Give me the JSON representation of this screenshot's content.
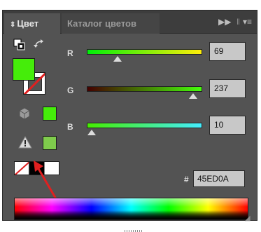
{
  "tabs": [
    {
      "label": "Цвет",
      "active": true
    },
    {
      "label": "Каталог цветов",
      "active": false
    }
  ],
  "tab_icons": [
    "collapse-icon",
    "panel-menu-icon"
  ],
  "fill_color": "#45ED0A",
  "channels": [
    {
      "label": "R",
      "value": "69",
      "level": 0.27,
      "gradient": [
        "#00ed0a",
        "#ffed0a"
      ]
    },
    {
      "label": "G",
      "value": "237",
      "level": 0.93,
      "gradient": [
        "#450000",
        "#45ff0a"
      ]
    },
    {
      "label": "B",
      "value": "10",
      "level": 0.04,
      "gradient": [
        "#45ed00",
        "#45edff"
      ]
    }
  ],
  "hex": {
    "symbol": "#",
    "value": "45ED0A"
  },
  "colors": {
    "panel": "#535353",
    "tabbar": "#3d3d3d",
    "field": "#c8c8c8",
    "websafe_swatch": "#7fcc4c",
    "arrow_annotation": "#e02020"
  }
}
